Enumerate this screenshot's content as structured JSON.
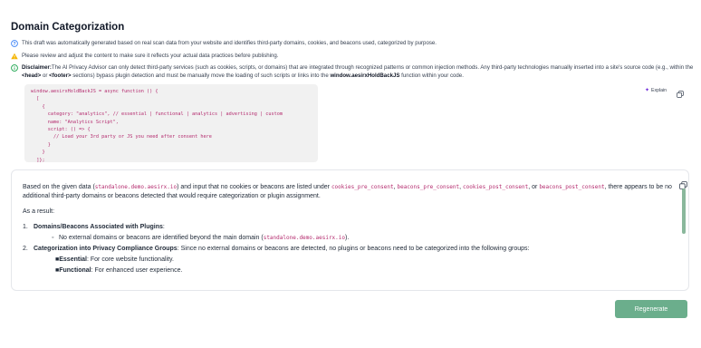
{
  "page": {
    "title": "Domain Categorization"
  },
  "notes": {
    "info": "This draft was automatically generated based on real scan data from your website and identifies third-party domains, cookies, and beacons used, categorized by purpose.",
    "warning": "Please review and adjust the content to make sure it reflects your actual data practices before publishing.",
    "disclaimer_label": "Disclaimer:",
    "disclaimer_text_1": "The AI Privacy Advisor can only detect third-party services (such as cookies, scripts, or domains) that are integrated through recognized patterns or common injection methods. Any third-party technologies manually inserted into a site's source code (e.g., within the ",
    "disclaimer_head": "<head>",
    "disclaimer_or": " or ",
    "disclaimer_footer": "<footer>",
    "disclaimer_text_2": " sections) bypass plugin detection and must be manually move the loading of such scripts or links into the ",
    "disclaimer_fn": "window.aesirxHoldBackJS",
    "disclaimer_text_3": " function within your code."
  },
  "code_snippet": "window.aesirxHoldBackJS = async function () {\n  [\n    {\n      category: \"analytics\", // essential | functional | analytics | advertising | custom\n      name: \"Analytics Script\",\n      script: () => {\n        // Load your 3rd party or JS you need after consent here\n      }\n    }\n  ]};",
  "toolbar": {
    "explain_label": "Explain"
  },
  "answer": {
    "intro_1": "Based on the given data (",
    "intro_domain": "standalone.demo.aesirx.io",
    "intro_2": ") and input that no cookies or beacons are listed under ",
    "key_cookies_pre": "cookies_pre_consent",
    "sep_1": ", ",
    "key_beacons_pre": "beacons_pre_consent",
    "sep_2": ", ",
    "key_cookies_post": "cookies_post_consent",
    "sep_3": ", or ",
    "key_beacons_post": "beacons_post_consent",
    "intro_3": ", there appears to be no additional third-party domains or beacons detected that would require categorization or plugin assignment.",
    "as_result": "As a result:",
    "item1_num": "1.",
    "item1_title": "Domains/Beacons Associated with Plugins",
    "item1_colon": ":",
    "item1_sub_1": "No external domains or beacons are identified beyond the main domain (",
    "item1_sub_domain": "standalone.demo.aesirx.io",
    "item1_sub_2": ").",
    "item2_num": "2.",
    "item2_title": "Categorization into Privacy Compliance Groups",
    "item2_text": ": Since no external domains or beacons are detected, no plugins or beacons need to be categorized into the following groups:",
    "group1_title": "Essential",
    "group1_text": ": For core website functionality.",
    "group2_title": "Functional",
    "group2_text": ": For enhanced user experience."
  },
  "actions": {
    "regenerate_label": "Regenerate"
  },
  "colors": {
    "accent": "#6bae8c",
    "code": "#b42b6e",
    "info": "#3b82f6",
    "warning": "#f5b400",
    "disclaimer": "#16a34a"
  },
  "icons": {
    "info": "help-circle-icon",
    "warning": "warning-triangle-icon",
    "disclaimer": "info-circle-icon",
    "explain": "sparkle-icon",
    "copy": "copy-icon"
  }
}
